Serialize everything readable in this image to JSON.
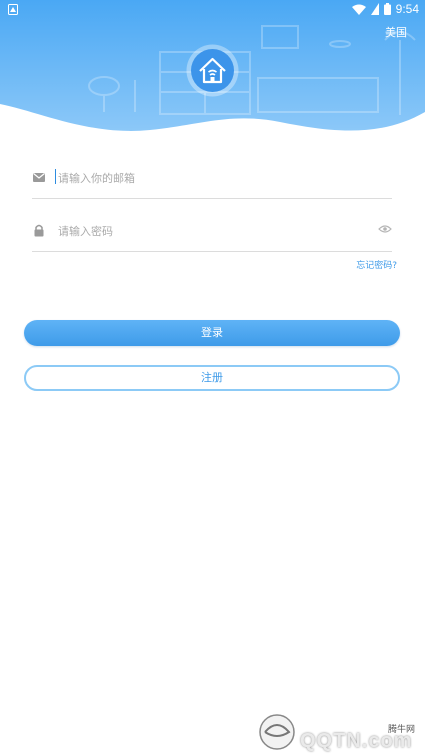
{
  "status_bar": {
    "time": "9:54"
  },
  "header": {
    "region": "美国"
  },
  "login_form": {
    "email_placeholder": "请输入你的邮箱",
    "password_placeholder": "请输入密码",
    "forgot_password": "忘记密码?",
    "login_button": "登录",
    "register_button": "注册"
  },
  "watermark": {
    "site": "腾牛网",
    "text": "QQTN.com"
  },
  "colors": {
    "primary": "#3e9be9",
    "header_top": "#4aa8f4",
    "header_bottom": "#8cc8f8",
    "border": "#8ccaf6"
  }
}
